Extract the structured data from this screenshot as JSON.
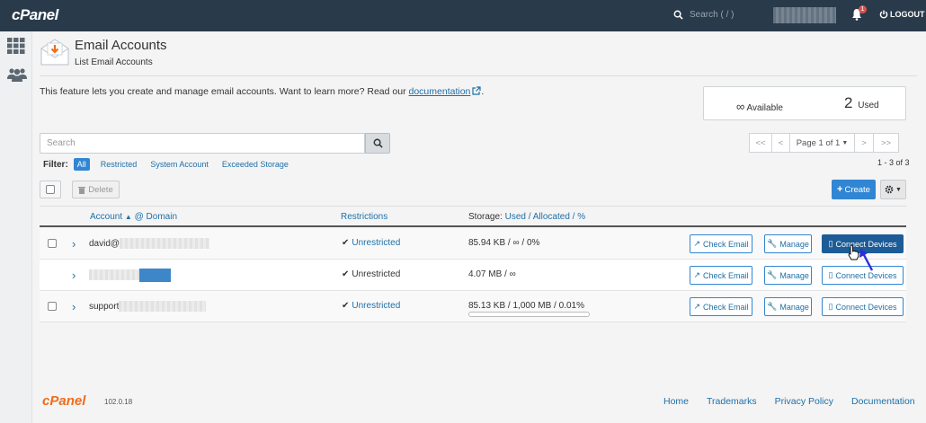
{
  "topbar": {
    "logo": "cPanel",
    "search_placeholder": "Search ( / )",
    "notification_count": "1",
    "logout_label": "LOGOUT"
  },
  "header": {
    "title": "Email Accounts",
    "subtitle": "List Email Accounts"
  },
  "intro": {
    "text": "This feature lets you create and manage email accounts. Want to learn more? Read our",
    "link": "documentation",
    "suffix": "."
  },
  "stats": {
    "available_symbol": "∞",
    "available_label": "Available",
    "used_count": "2",
    "used_label": "Used"
  },
  "search": {
    "placeholder": "Search"
  },
  "filter": {
    "label": "Filter:",
    "options": [
      "All",
      "Restricted",
      "System Account",
      "Exceeded Storage"
    ]
  },
  "pager": {
    "first": "<<",
    "prev": "<",
    "page": "Page 1 of 1",
    "next": ">",
    "last": ">>",
    "count": "1 - 3 of 3"
  },
  "toolbar": {
    "delete_label": "Delete",
    "create_label": "Create"
  },
  "table": {
    "headers": {
      "account": "Account",
      "domain": "@ Domain",
      "restrictions": "Restrictions",
      "storage_prefix": "Storage:",
      "used": "Used",
      "sep1": "/",
      "allocated": "Allocated",
      "sep2": "/",
      "percent": "%"
    },
    "rows": [
      {
        "account": "david@",
        "restriction": "Unrestricted",
        "storage": "85.94 KB / ∞ / 0%"
      },
      {
        "account": "",
        "restriction": "Unrestricted",
        "storage": "4.07 MB / ∞"
      },
      {
        "account": "support",
        "restriction": "Unrestricted",
        "storage": "85.13 KB / 1,000 MB / 0.01%",
        "usage_fraction": 0.0001
      }
    ],
    "actions": {
      "check_email": "Check Email",
      "manage": "Manage",
      "connect_devices": "Connect Devices"
    }
  },
  "footer": {
    "logo": "cPanel",
    "version": "102.0.18",
    "links": [
      "Home",
      "Trademarks",
      "Privacy Policy",
      "Documentation"
    ]
  },
  "colors": {
    "topbar": "#293a4a",
    "accent": "#3186d3",
    "primary_dark": "#1d5c96",
    "link": "#1e6fa8",
    "brand_orange": "#ef6c1c"
  }
}
